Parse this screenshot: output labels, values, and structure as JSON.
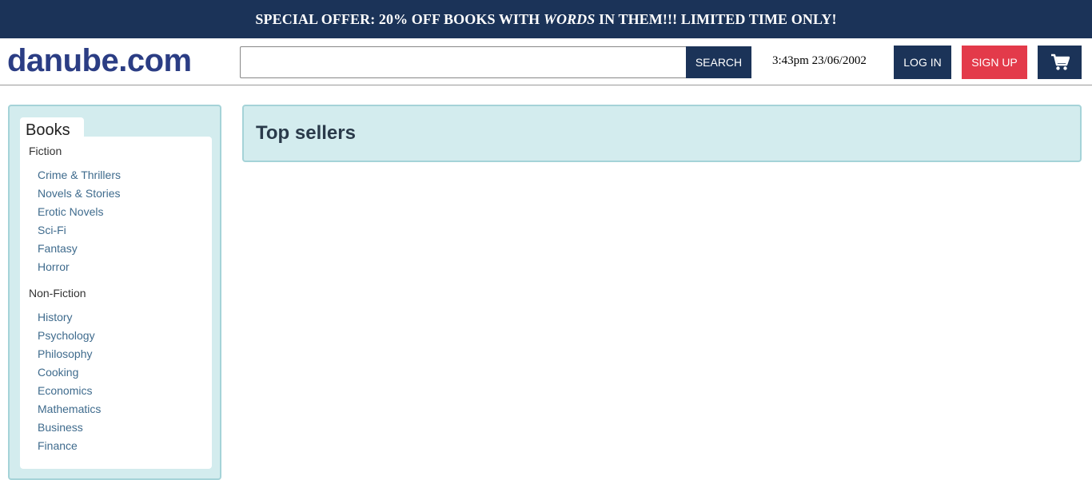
{
  "banner": {
    "text_before": "SPECIAL OFFER: 20% OFF BOOKS WITH ",
    "text_emphasis": "WORDS",
    "text_after": " IN THEM!!! LIMITED TIME ONLY!"
  },
  "header": {
    "logo": "danube.com",
    "search": {
      "value": "",
      "placeholder": "",
      "button_label": "SEARCH"
    },
    "clock": "3:43pm 23/06/2002",
    "login_label": "LOG IN",
    "signup_label": "SIGN UP",
    "cart_icon": "cart-icon"
  },
  "sidebar": {
    "tab_label": "Books",
    "sections": [
      {
        "title": "Fiction",
        "items": [
          "Crime & Thrillers",
          "Novels & Stories",
          "Erotic Novels",
          "Sci-Fi",
          "Fantasy",
          "Horror"
        ]
      },
      {
        "title": "Non-Fiction",
        "items": [
          "History",
          "Psychology",
          "Philosophy",
          "Cooking",
          "Economics",
          "Mathematics",
          "Business",
          "Finance"
        ]
      }
    ]
  },
  "main": {
    "title": "Top sellers"
  },
  "colors": {
    "navy": "#1b3358",
    "red": "#e33a4a",
    "logo": "#2b3d84",
    "panel": "#d3ecee",
    "link": "#3f6b8d"
  }
}
